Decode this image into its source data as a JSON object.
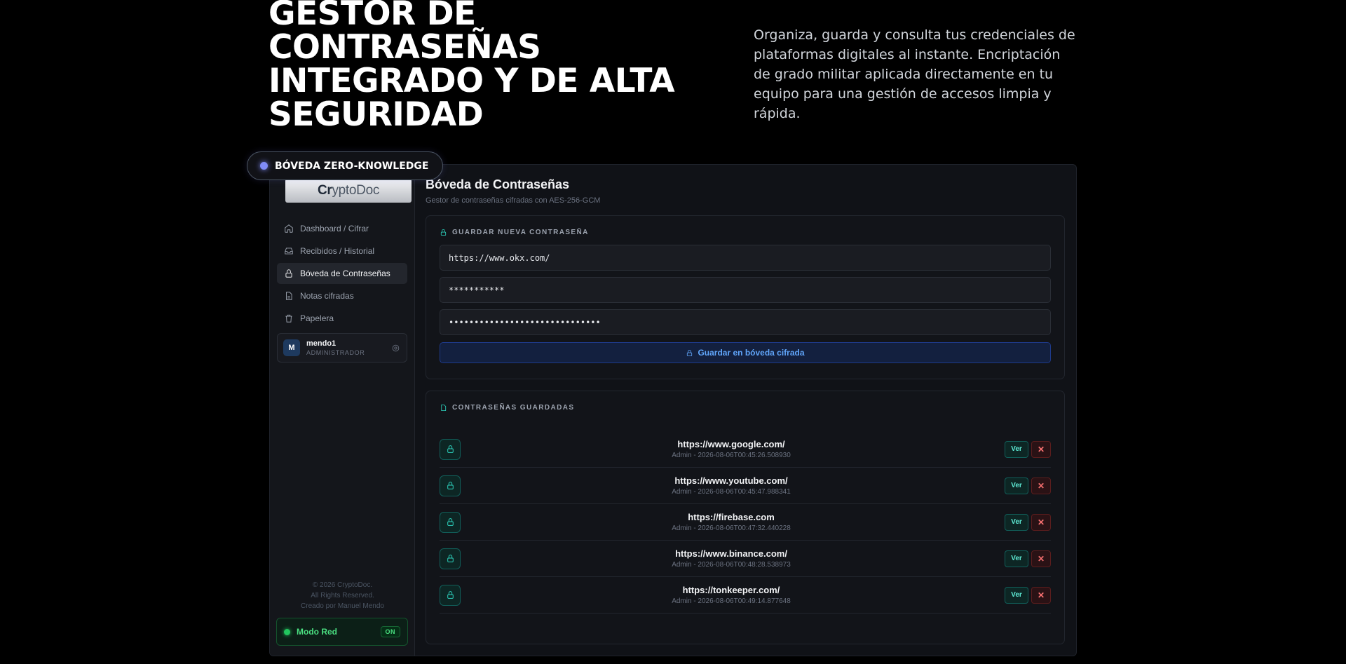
{
  "hero": {
    "title_line1": "GESTOR DE",
    "title_line2": "CONTRASEÑAS",
    "title_line3": "INTEGRADO Y DE ALTA",
    "title_line4": "SEGURIDAD",
    "description": "Organiza, guarda y consulta tus credenciales de plataformas digitales al instante. Encriptación de grado militar aplicada directamente en tu equipo para una gestión de accesos limpia y rápida."
  },
  "badge": {
    "label": "BÓVEDA ZERO-KNOWLEDGE"
  },
  "sidebar": {
    "logo_bold": "CryptoDoc",
    "logo_bold_part": "Cr",
    "logo_rest": "yptoDoc",
    "items": [
      {
        "label": "Dashboard / Cifrar",
        "icon": "home-icon"
      },
      {
        "label": "Recibidos / Historial",
        "icon": "inbox-icon"
      },
      {
        "label": "Bóveda de Contraseñas",
        "icon": "lock-icon",
        "active": true
      },
      {
        "label": "Notas cifradas",
        "icon": "document-icon"
      },
      {
        "label": "Papelera",
        "icon": "trash-icon"
      }
    ],
    "user": {
      "initial": "M",
      "name": "mendo1",
      "role": "ADMINISTRADOR"
    },
    "copyright_line1": "© 2026 CryptoDoc.",
    "copyright_line2": "All Rights Reserved.",
    "copyright_line3": "Creado por Manuel Mendo",
    "network_mode": {
      "label": "Modo Red",
      "state": "ON"
    }
  },
  "main": {
    "title": "Bóveda de Contraseñas",
    "subtitle": "Gestor de contraseñas cifradas con AES-256-GCM",
    "new_password": {
      "heading": "GUARDAR NUEVA CONTRASEÑA",
      "site_value": "https://www.okx.com/",
      "user_value": "***********",
      "password_value": "••••••••••••••••••••••••••••••",
      "save_label": "Guardar en bóveda cifrada"
    },
    "saved": {
      "heading": "CONTRASEÑAS GUARDADAS",
      "view_label": "Ver",
      "delete_label": "✕",
      "entries": [
        {
          "url": "https://www.google.com/",
          "meta": "Admin - 2026-08-06T00:45:26.508930"
        },
        {
          "url": "https://www.youtube.com/",
          "meta": "Admin - 2026-08-06T00:45:47.988341"
        },
        {
          "url": "https://firebase.com",
          "meta": "Admin - 2026-08-06T00:47:32.440228"
        },
        {
          "url": "https://www.binance.com/",
          "meta": "Admin - 2026-08-06T00:48:28.538973"
        },
        {
          "url": "https://tonkeeper.com/",
          "meta": "Admin - 2026-08-06T00:49:14.877648"
        }
      ]
    }
  },
  "colors": {
    "accent_teal": "#2dd4bf",
    "accent_blue": "#60a5fa",
    "danger_red": "#f87171",
    "network_green": "#22c55e",
    "badge_dot": "#818cf8"
  }
}
